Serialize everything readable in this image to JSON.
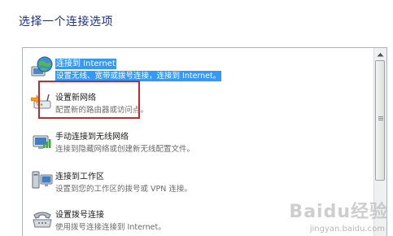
{
  "heading": "选择一个连接选项",
  "options": [
    {
      "title": "连接到 Internet",
      "description": "设置无线、宽带或拨号连接，连接到 Internet。",
      "icon": "globe-network-icon",
      "selected": true
    },
    {
      "title": "设置新网络",
      "description": "配置新的路由器或访问点。",
      "icon": "router-icon",
      "selected": false
    },
    {
      "title": "手动连接到无线网络",
      "description": "连接到隐藏网络或创建新无线配置文件。",
      "icon": "wireless-monitor-icon",
      "selected": false
    },
    {
      "title": "连接到工作区",
      "description": "设置到您的工作区的拨号或 VPN 连接。",
      "icon": "workplace-computer-icon",
      "selected": false
    },
    {
      "title": "设置拨号连接",
      "description": "使用拨号连接连接到 Internet。",
      "icon": "dialup-phone-icon",
      "selected": false
    }
  ],
  "watermark": {
    "logo": "Baidu经验",
    "url": "jingyan.baidu.com"
  },
  "colors": {
    "heading": "#1e3287",
    "selection": "#3399ff",
    "annotation_box": "#c8282d"
  }
}
